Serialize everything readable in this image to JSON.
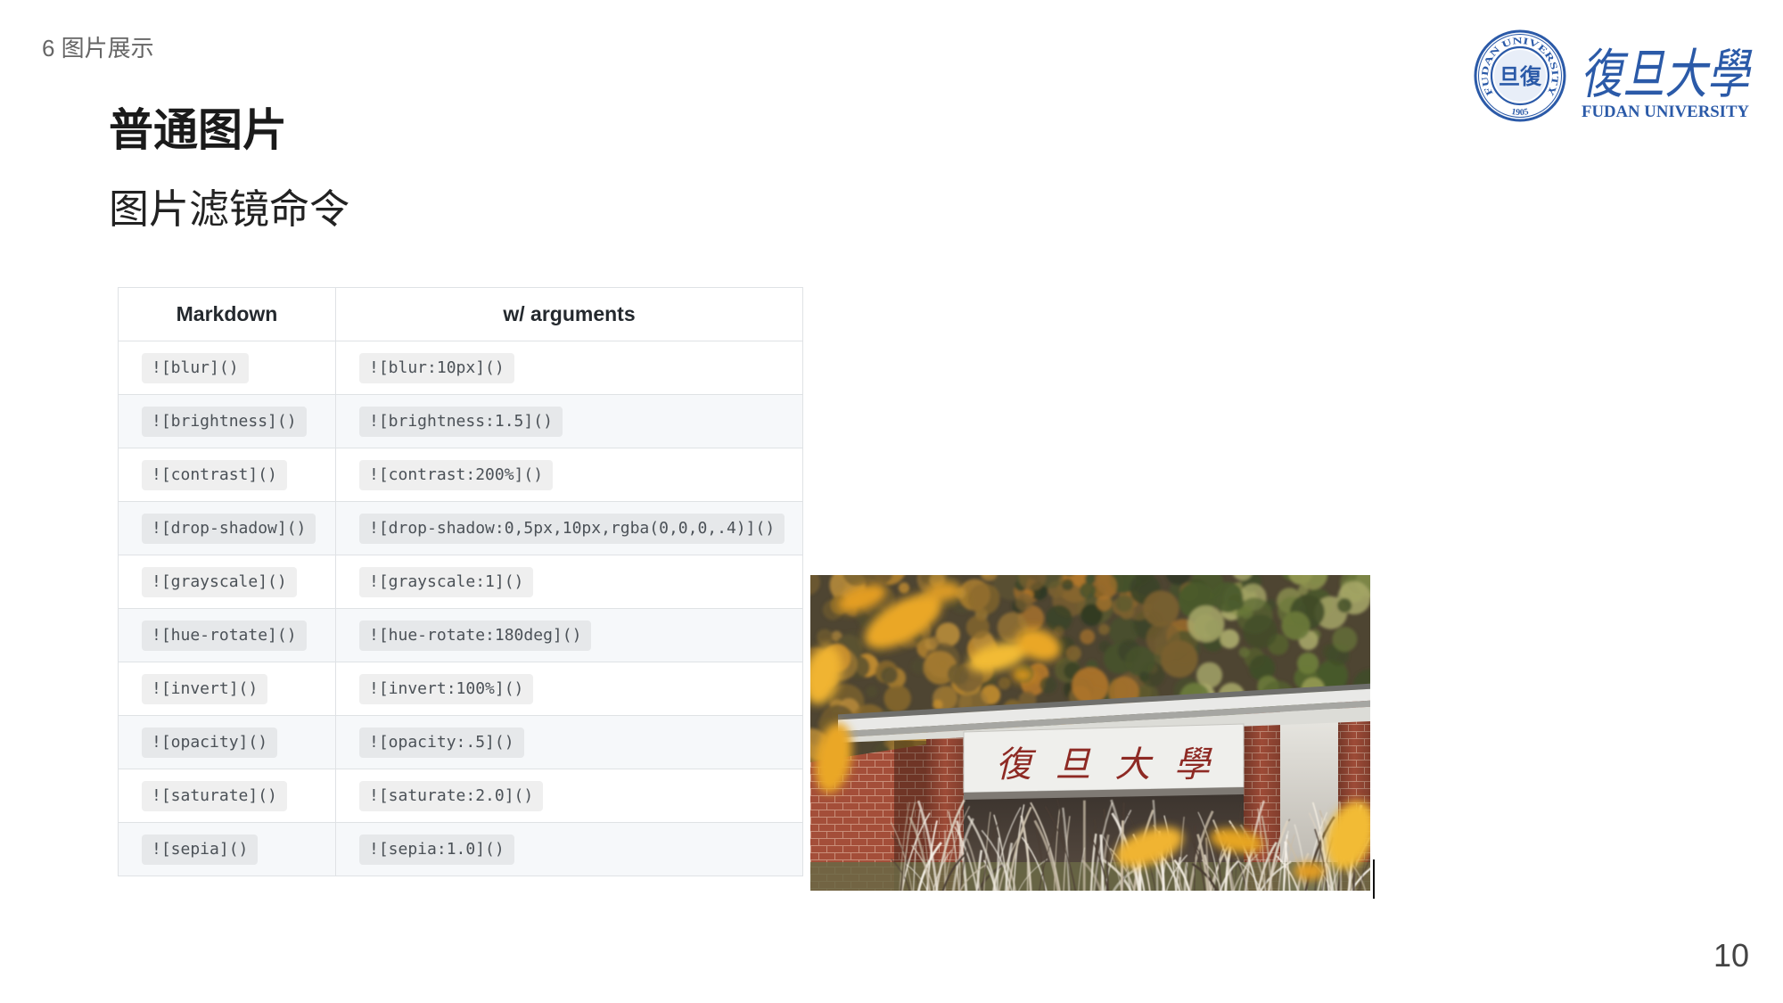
{
  "section": "6 图片展示",
  "title": "普通图片",
  "subtitle": "图片滤镜命令",
  "page_number": "10",
  "logo": {
    "seal_ring": "FUDAN UNIVERSITY",
    "seal_year": "1905",
    "seal_center": "復旦",
    "name_cn": "復旦大學",
    "name_en": "FUDAN UNIVERSITY"
  },
  "table": {
    "headers": [
      "Markdown",
      "w/ arguments"
    ],
    "rows": [
      {
        "markdown": "![blur]()",
        "with_arguments": "![blur:10px]()"
      },
      {
        "markdown": "![brightness]()",
        "with_arguments": "![brightness:1.5]()"
      },
      {
        "markdown": "![contrast]()",
        "with_arguments": "![contrast:200%]()"
      },
      {
        "markdown": "![drop-shadow]()",
        "with_arguments": "![drop-shadow:0,5px,10px,rgba(0,0,0,.4)]()"
      },
      {
        "markdown": "![grayscale]()",
        "with_arguments": "![grayscale:1]()"
      },
      {
        "markdown": "![hue-rotate]()",
        "with_arguments": "![hue-rotate:180deg]()"
      },
      {
        "markdown": "![invert]()",
        "with_arguments": "![invert:100%]()"
      },
      {
        "markdown": "![opacity]()",
        "with_arguments": "![opacity:.5]()"
      },
      {
        "markdown": "![saturate]()",
        "with_arguments": "![saturate:2.0]()"
      },
      {
        "markdown": "![sepia]()",
        "with_arguments": "![sepia:1.0]()"
      }
    ]
  },
  "photo": {
    "sign_text": "復旦大學"
  },
  "colors": {
    "logo_blue": "#2b5aa8",
    "sign_red": "#8e2a24",
    "leaf_yellow": "#eaa726",
    "table_border": "#dfe2e5",
    "row_alt": "#f6f8fa",
    "code_text": "#4b5157"
  }
}
